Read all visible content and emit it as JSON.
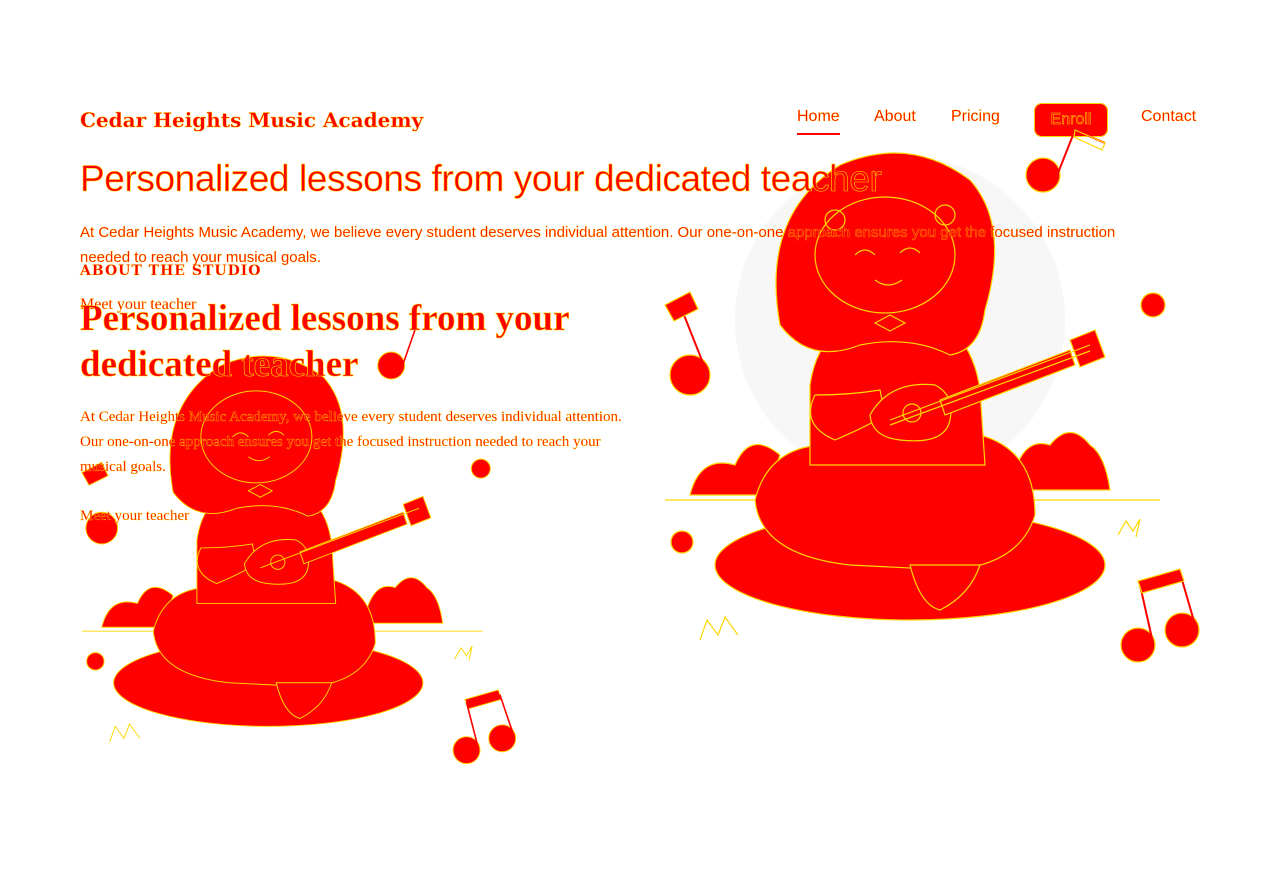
{
  "site": {
    "title": "Cedar Heights Music Academy"
  },
  "nav": {
    "home": "Home",
    "about": "About",
    "pricing": "Pricing",
    "enroll": "Enroll",
    "contact": "Contact"
  },
  "hero": {
    "heading": "Personalized lessons from your dedicated teacher",
    "text": "At Cedar Heights Music Academy, we believe every student deserves individual attention. Our one-on-one approach ensures you get the focused instruction needed to reach your musical goals."
  },
  "about": {
    "eyebrow": "ABOUT THE STUDIO",
    "meet_label": "Meet your teacher",
    "heading": "Personalized lessons from your dedicated teacher",
    "text": "At Cedar Heights Music Academy, we believe every student deserves individual attention. Our one-on-one approach ensures you get the focused instruction needed to reach your musical goals.",
    "link": "Meet your teacher"
  },
  "illustration": {
    "subject": "girl-playing-ukulele-illustration",
    "colors": {
      "primary": "#ff0000",
      "outline": "#ffd700",
      "halo": "#f7f7f7"
    }
  }
}
